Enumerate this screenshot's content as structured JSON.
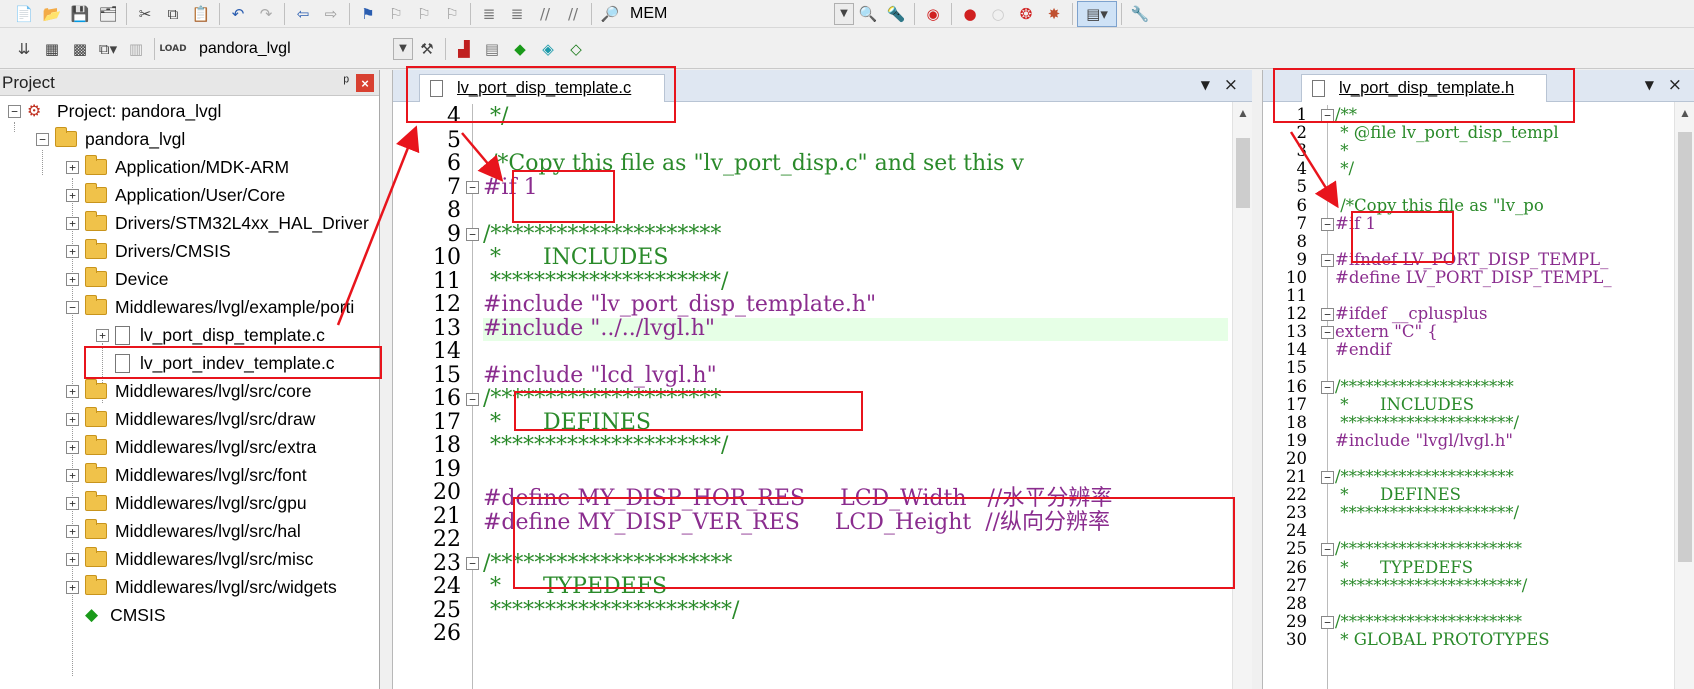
{
  "toolbar1": {
    "target_combo": "MEM"
  },
  "toolbar2": {
    "project_combo": "pandora_lvgl"
  },
  "project": {
    "title": "Project",
    "pin": "ᵖ",
    "close": "×",
    "root": "Project: pandora_lvgl",
    "target": "pandora_lvgl",
    "items": [
      {
        "label": "Application/MDK-ARM",
        "expander": "+"
      },
      {
        "label": "Application/User/Core",
        "expander": "+"
      },
      {
        "label": "Drivers/STM32L4xx_HAL_Driver",
        "expander": "+"
      },
      {
        "label": "Drivers/CMSIS",
        "expander": "+"
      },
      {
        "label": "Device",
        "expander": "+"
      },
      {
        "label": "Middlewares/lvgl/example/porti",
        "expander": "−"
      },
      {
        "label": "lv_port_disp_template.c",
        "expander": "+"
      },
      {
        "label": "lv_port_indev_template.c",
        "expander": ""
      },
      {
        "label": "Middlewares/lvgl/src/core",
        "expander": "+"
      },
      {
        "label": "Middlewares/lvgl/src/draw",
        "expander": "+"
      },
      {
        "label": "Middlewares/lvgl/src/extra",
        "expander": "+"
      },
      {
        "label": "Middlewares/lvgl/src/font",
        "expander": "+"
      },
      {
        "label": "Middlewares/lvgl/src/gpu",
        "expander": "+"
      },
      {
        "label": "Middlewares/lvgl/src/hal",
        "expander": "+"
      },
      {
        "label": "Middlewares/lvgl/src/misc",
        "expander": "+"
      },
      {
        "label": "Middlewares/lvgl/src/widgets",
        "expander": "+"
      },
      {
        "label": "CMSIS",
        "expander": ""
      }
    ]
  },
  "editor_left": {
    "tab": "lv_port_disp_template.c",
    "dropdown": "▼",
    "close": "×",
    "lines": [
      {
        "n": "4",
        "t": " */",
        "c": "green"
      },
      {
        "n": "5",
        "t": "",
        "c": "green"
      },
      {
        "n": "6",
        "t": " /*Copy this file as \"lv_port_disp.c\" and set this v",
        "c": "green"
      },
      {
        "n": "7",
        "t": "#if 1",
        "c": "purple"
      },
      {
        "n": "8",
        "t": "",
        "c": "blk"
      },
      {
        "n": "9",
        "t": "/*********************",
        "c": "green"
      },
      {
        "n": "10",
        "t": " *      INCLUDES",
        "c": "green"
      },
      {
        "n": "11",
        "t": " *********************/",
        "c": "green"
      },
      {
        "n": "12",
        "t": "#include \"lv_port_disp_template.h\"",
        "c": "purple"
      },
      {
        "n": "13",
        "t": "#include \"../../lvgl.h\"",
        "c": "purple"
      },
      {
        "n": "14",
        "t": "",
        "c": "blk"
      },
      {
        "n": "15",
        "t": "#include \"lcd_lvgl.h\"",
        "c": "purple"
      },
      {
        "n": "16",
        "t": "/*********************",
        "c": "green"
      },
      {
        "n": "17",
        "t": " *      DEFINES",
        "c": "green"
      },
      {
        "n": "18",
        "t": " *********************/",
        "c": "green"
      },
      {
        "n": "19",
        "t": "",
        "c": "blk"
      },
      {
        "n": "20",
        "t": "#define MY_DISP_HOR_RES     LCD_Width   //水平分辨率",
        "c": "purple"
      },
      {
        "n": "21",
        "t": "#define MY_DISP_VER_RES     LCD_Height  //纵向分辨率",
        "c": "purple"
      },
      {
        "n": "22",
        "t": "",
        "c": "blk"
      },
      {
        "n": "23",
        "t": "/**********************",
        "c": "green"
      },
      {
        "n": "24",
        "t": " *      TYPEDEFS",
        "c": "green"
      },
      {
        "n": "25",
        "t": " **********************/",
        "c": "green"
      },
      {
        "n": "26",
        "t": "",
        "c": "blk"
      }
    ]
  },
  "editor_right": {
    "tab": "lv_port_disp_template.h",
    "dropdown": "▼",
    "close": "×",
    "lines": [
      {
        "n": "1",
        "t": "/**",
        "c": "green"
      },
      {
        "n": "2",
        "t": " * @file lv_port_disp_templ",
        "c": "green"
      },
      {
        "n": "3",
        "t": " *",
        "c": "green"
      },
      {
        "n": "4",
        "t": " */",
        "c": "green"
      },
      {
        "n": "5",
        "t": "",
        "c": "blk"
      },
      {
        "n": "6",
        "t": " /*Copy this file as \"lv_po",
        "c": "green"
      },
      {
        "n": "7",
        "t": "#if 1",
        "c": "purple"
      },
      {
        "n": "8",
        "t": "",
        "c": "blk"
      },
      {
        "n": "9",
        "t": "#ifndef LV_PORT_DISP_TEMPL_",
        "c": "purple"
      },
      {
        "n": "10",
        "t": "#define LV_PORT_DISP_TEMPL_",
        "c": "purple"
      },
      {
        "n": "11",
        "t": "",
        "c": "blk"
      },
      {
        "n": "12",
        "t": "#ifdef __cplusplus",
        "c": "purple"
      },
      {
        "n": "13",
        "t": "extern \"C\" {",
        "c": "purple"
      },
      {
        "n": "14",
        "t": "#endif",
        "c": "purple"
      },
      {
        "n": "15",
        "t": "",
        "c": "blk"
      },
      {
        "n": "16",
        "t": "/*********************",
        "c": "green"
      },
      {
        "n": "17",
        "t": " *      INCLUDES",
        "c": "green"
      },
      {
        "n": "18",
        "t": " *********************/",
        "c": "green"
      },
      {
        "n": "19",
        "t": "#include \"lvgl/lvgl.h\"",
        "c": "purple"
      },
      {
        "n": "20",
        "t": "",
        "c": "blk"
      },
      {
        "n": "21",
        "t": "/*********************",
        "c": "green"
      },
      {
        "n": "22",
        "t": " *      DEFINES",
        "c": "green"
      },
      {
        "n": "23",
        "t": " *********************/",
        "c": "green"
      },
      {
        "n": "24",
        "t": "",
        "c": "blk"
      },
      {
        "n": "25",
        "t": "/**********************",
        "c": "green"
      },
      {
        "n": "26",
        "t": " *      TYPEDEFS",
        "c": "green"
      },
      {
        "n": "27",
        "t": " **********************/",
        "c": "green"
      },
      {
        "n": "28",
        "t": "",
        "c": "blk"
      },
      {
        "n": "29",
        "t": "/**********************",
        "c": "green"
      },
      {
        "n": "30",
        "t": " * GLOBAL PROTOTYPES",
        "c": "green"
      }
    ]
  },
  "colors": {
    "annotation": "#e8141c",
    "highlight_line": "#e6ffe6"
  }
}
